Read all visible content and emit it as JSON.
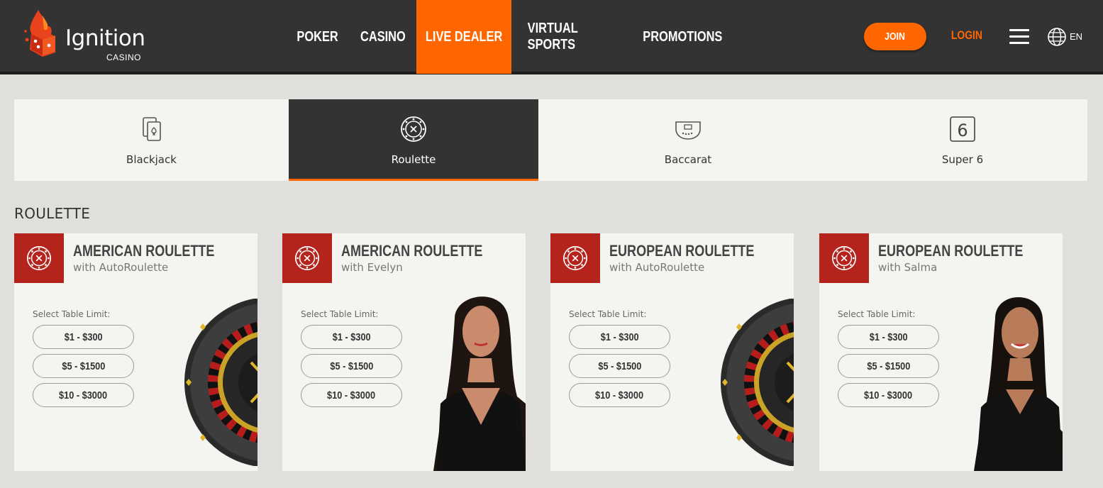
{
  "header": {
    "logo_text": "Ignition",
    "logo_sub": "CASINO",
    "nav": [
      {
        "label": "POKER",
        "active": false
      },
      {
        "label": "CASINO",
        "active": false
      },
      {
        "label": "LIVE DEALER",
        "active": true
      },
      {
        "label": "VIRTUAL SPORTS",
        "active": false
      },
      {
        "label": "PROMOTIONS",
        "active": false
      }
    ],
    "join_label": "JOIN",
    "login_label": "LOGIN",
    "language": "EN"
  },
  "tabs": [
    {
      "label": "Blackjack",
      "icon": "blackjack-cards-icon",
      "active": false
    },
    {
      "label": "Roulette",
      "icon": "roulette-wheel-icon",
      "active": true
    },
    {
      "label": "Baccarat",
      "icon": "baccarat-table-icon",
      "active": false
    },
    {
      "label": "Super 6",
      "icon": "super6-icon",
      "active": false
    }
  ],
  "section_title": "ROULETTE",
  "cards": [
    {
      "title": "AMERICAN ROULETTE",
      "subtitle": "with AutoRoulette",
      "limit_label": "Select Table Limit:",
      "limits": [
        "$1 - $300",
        "$5 - $1500",
        "$10 - $3000"
      ],
      "image": "roulette-wheel"
    },
    {
      "title": "AMERICAN ROULETTE",
      "subtitle": "with Evelyn",
      "limit_label": "Select Table Limit:",
      "limits": [
        "$1 - $300",
        "$5 - $1500",
        "$10 - $3000"
      ],
      "image": "dealer"
    },
    {
      "title": "EUROPEAN ROULETTE",
      "subtitle": "with AutoRoulette",
      "limit_label": "Select Table Limit:",
      "limits": [
        "$1 - $300",
        "$5 - $1500",
        "$10 - $3000"
      ],
      "image": "roulette-wheel"
    },
    {
      "title": "EUROPEAN ROULETTE",
      "subtitle": "with Salma",
      "limit_label": "Select Table Limit:",
      "limits": [
        "$1 - $300",
        "$5 - $1500",
        "$10 - $3000"
      ],
      "image": "dealer"
    }
  ],
  "colors": {
    "accent": "#ff6600",
    "header_bg": "#333333",
    "badge_red": "#b5231d",
    "page_bg": "#e0dfdb",
    "card_bg": "#f4f4f0"
  }
}
